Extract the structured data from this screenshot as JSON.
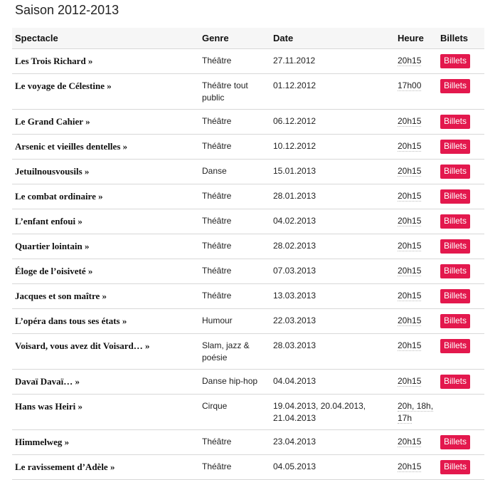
{
  "title": "Saison 2012-2013",
  "columns": {
    "show": "Spectacle",
    "genre": "Genre",
    "date": "Date",
    "time": "Heure",
    "tickets": "Billets"
  },
  "rows": [
    {
      "show": "Les Trois Richard »",
      "genre": "Théâtre",
      "date": "27.11.2012",
      "time": "20h15",
      "tickets": "Billets"
    },
    {
      "show": "Le voyage de Célestine »",
      "genre": "Théâtre tout public",
      "date": "01.12.2012",
      "time": "17h00",
      "tickets": "Billets"
    },
    {
      "show": "Le Grand Cahier »",
      "genre": "Théâtre",
      "date": "06.12.2012",
      "time": "20h15",
      "tickets": "Billets"
    },
    {
      "show": "Arsenic et vieilles dentelles »",
      "genre": "Théâtre",
      "date": "10.12.2012",
      "time": "20h15",
      "tickets": "Billets"
    },
    {
      "show": "Jetuilnousvousils »",
      "genre": "Danse",
      "date": "15.01.2013",
      "time": "20h15",
      "tickets": "Billets"
    },
    {
      "show": "Le combat ordinaire »",
      "genre": "Théâtre",
      "date": "28.01.2013",
      "time": "20h15",
      "tickets": "Billets"
    },
    {
      "show": "L’enfant enfoui »",
      "genre": "Théâtre",
      "date": "04.02.2013",
      "time": "20h15",
      "tickets": "Billets"
    },
    {
      "show": "Quartier lointain »",
      "genre": "Théâtre",
      "date": "28.02.2013",
      "time": "20h15",
      "tickets": "Billets"
    },
    {
      "show": "Éloge de l’oisiveté »",
      "genre": "Théâtre",
      "date": "07.03.2013",
      "time": "20h15",
      "tickets": "Billets"
    },
    {
      "show": "Jacques et son maître »",
      "genre": "Théâtre",
      "date": "13.03.2013",
      "time": "20h15",
      "tickets": "Billets"
    },
    {
      "show": "L’opéra dans tous ses états »",
      "genre": "Humour",
      "date": "22.03.2013",
      "time": "20h15",
      "tickets": "Billets"
    },
    {
      "show": "Voisard, vous avez dit Voisard… »",
      "genre": "Slam, jazz & poésie",
      "date": "28.03.2013",
      "time": "20h15",
      "tickets": "Billets"
    },
    {
      "show": "Davaï Davaï… »",
      "genre": "Danse hip-hop",
      "date": "04.04.2013",
      "time": "20h15",
      "tickets": "Billets"
    },
    {
      "show": "Hans was Heiri »",
      "genre": "Cirque",
      "date": "19.04.2013, 20.04.2013, 21.04.2013",
      "time": "20h, 18h, 17h",
      "tickets": ""
    },
    {
      "show": "Himmelweg »",
      "genre": "Théâtre",
      "date": "23.04.2013",
      "time": "20h15",
      "tickets": "Billets"
    },
    {
      "show": "Le ravissement d’Adèle »",
      "genre": "Théâtre",
      "date": "04.05.2013",
      "time": "20h15",
      "tickets": "Billets"
    }
  ],
  "colors": {
    "ticket_button": "#e3184d",
    "header_bg": "#f6f6f6",
    "row_border": "#d8d8d8"
  }
}
